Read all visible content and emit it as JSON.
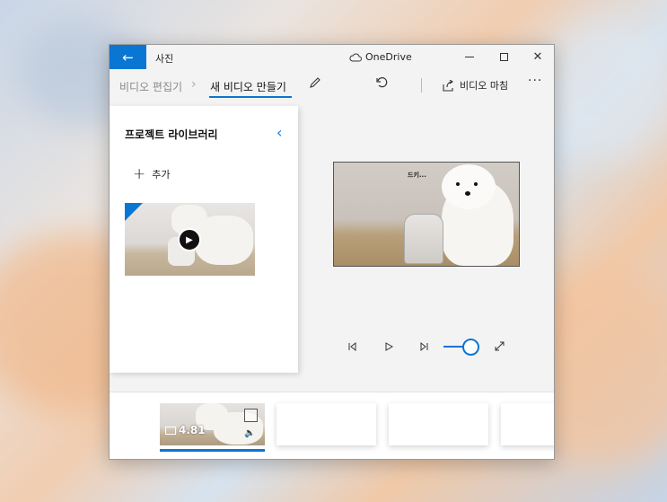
{
  "app": {
    "title": "사진",
    "cloud_label": "OneDrive"
  },
  "toolbar": {
    "breadcrumb_parent": "비디오 편집기",
    "breadcrumb_current": "새 비디오 만들기",
    "finish_label": "비디오 마침"
  },
  "library": {
    "title": "프로젝트 라이브러리",
    "add_label": "추가"
  },
  "preview": {
    "caption": "드키..."
  },
  "storyboard": {
    "clip_duration": "4.81"
  },
  "colors": {
    "accent": "#0a76d3"
  }
}
